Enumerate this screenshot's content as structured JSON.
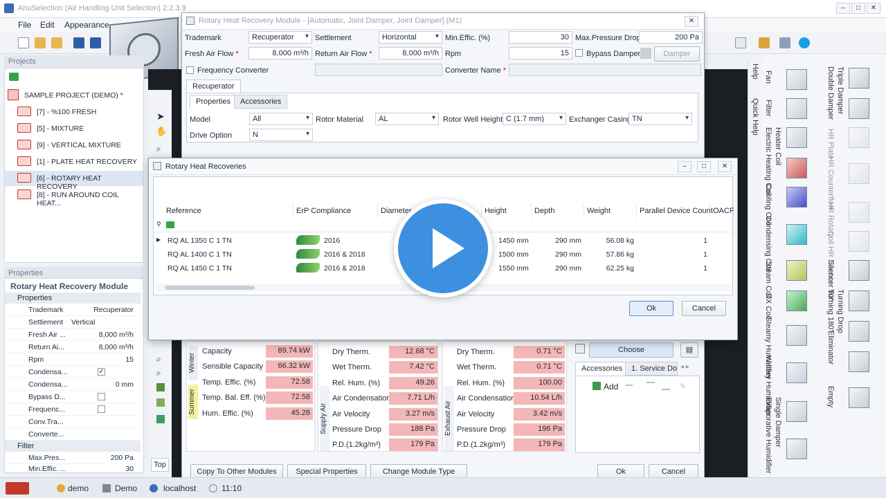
{
  "app": {
    "title": "AhuSelection (Air Handling Unit Selection) 2.2.3.9"
  },
  "menu": [
    "File",
    "Edit",
    "Appearance"
  ],
  "projects": {
    "header": "Projects",
    "root": "SAMPLE PROJECT (DEMO) *",
    "items": [
      "[7] - %100 FRESH",
      "[5] - MIXTURE",
      "[9] - VERTICAL MIXTURE",
      "[1] - PLATE HEAT RECOVERY",
      "[6] - ROTARY HEAT RECOVERY",
      "[8] - RUN AROUND COIL HEAT..."
    ]
  },
  "properties": {
    "header": "Properties",
    "title": "Rotary Heat Recovery Module",
    "group1": "Properties",
    "rows": [
      {
        "k": "Trademark",
        "v": "Recuperator"
      },
      {
        "k": "Settlement",
        "v": "Vertical"
      },
      {
        "k": "Fresh Air ...",
        "v": "8,000 m³/h"
      },
      {
        "k": "Return Ai...",
        "v": "8,000 m³/h"
      },
      {
        "k": "Rpm",
        "v": "15"
      },
      {
        "k": "Condensa...",
        "v": ""
      },
      {
        "k": "Condensa...",
        "v": "0 mm"
      },
      {
        "k": "Bypass D...",
        "v": ""
      },
      {
        "k": "Frequenc...",
        "v": ""
      },
      {
        "k": "Conv.Tra...",
        "v": ""
      },
      {
        "k": "Converte...",
        "v": ""
      }
    ],
    "group2": "Filter",
    "rows2": [
      {
        "k": "Max.Pres...",
        "v": "200 Pa"
      },
      {
        "k": "Min.Effic. ...",
        "v": "30"
      }
    ]
  },
  "module": {
    "title": "Rotary Heat Recovery Module - [Automatic, Joint Damper, Joint Damper] (M1)",
    "trademark_label": "Trademark",
    "trademark": "Recuperator",
    "settlement_label": "Settlement",
    "settlement": "Horizontal",
    "mineff_label": "Min.Effic. (%)",
    "mineff": "30",
    "maxpd_label": "Max.Pressure Drop",
    "maxpd": "200 Pa",
    "fresh_label": "Fresh Air Flow",
    "fresh": "8,000 m³/h",
    "return_label": "Return Air Flow",
    "return": "8,000 m³/h",
    "rpm_label": "Rpm",
    "rpm": "15",
    "bypass_label": "Bypass Damper",
    "damper_btn": "Damper",
    "freq_label": "Frequency Converter",
    "conv_label": "Converter Name",
    "tab_recuperator": "Recuperator",
    "tab_properties": "Properties",
    "tab_accessories": "Accessories",
    "model_label": "Model",
    "model": "All",
    "rotor_label": "Rotor Material",
    "rotor": "AL",
    "well_label": "Rotor Well Height",
    "well": "C (1.7 mm)",
    "casing_label": "Exchanger Casing",
    "casing": "TN",
    "drive_label": "Drive Option",
    "drive": "N",
    "winter": "Winter",
    "summer": "Summer",
    "perf": [
      {
        "k": "Capacity",
        "v": "89.74 kW"
      },
      {
        "k": "Sensible Capacity",
        "v": "66.32 kW"
      },
      {
        "k": "Temp. Effic. (%)",
        "v": "72.58"
      },
      {
        "k": "Temp. Bal. Eff. (%)",
        "v": "72.58"
      },
      {
        "k": "Hum. Effic. (%)",
        "v": "45.28"
      }
    ],
    "supply_label": "Supply Air",
    "supply": [
      {
        "k": "Dry Therm.",
        "v": "12.68 °C"
      },
      {
        "k": "Wet Therm.",
        "v": "7.42 °C"
      },
      {
        "k": "Rel. Hum. (%)",
        "v": "49.26"
      },
      {
        "k": "Air Condensation",
        "v": "7.71 L/h"
      },
      {
        "k": "Air Velocity",
        "v": "3.27 m/s"
      },
      {
        "k": "Pressure Drop",
        "v": "188 Pa"
      },
      {
        "k": "P.D.(1.2kg/m³)",
        "v": "179 Pa"
      }
    ],
    "exhaust_label": "Exhaust Air",
    "exhaust": [
      {
        "k": "Dry Therm.",
        "v": "0.71 °C"
      },
      {
        "k": "Wet Therm.",
        "v": "0.71 °C"
      },
      {
        "k": "Rel. Hum. (%)",
        "v": "100.00"
      },
      {
        "k": "Air Condensation",
        "v": "10.54 L/h"
      },
      {
        "k": "Air Velocity",
        "v": "3.42 m/s"
      },
      {
        "k": "Pressure Drop",
        "v": "196 Pa"
      },
      {
        "k": "P.D.(1.2kg/m³)",
        "v": "179 Pa"
      }
    ],
    "choose_btn": "Choose",
    "acc_tab1": "Accessories",
    "acc_tab2": "1. Service Doc",
    "add_btn": "Add",
    "copy_btn": "Copy To Other Modules",
    "special_btn": "Special Properties",
    "change_btn": "Change Module Type",
    "ok": "Ok",
    "cancel": "Cancel"
  },
  "rotary": {
    "title": "Rotary Heat Recoveries",
    "columns": [
      "Reference",
      "ErP Compliance",
      "Diameter",
      "Height",
      "Depth",
      "Weight",
      "Parallel Device Count",
      "OACF"
    ],
    "rows": [
      {
        "ref": "RQ AL 1350 C 1 TN",
        "erp": "2016",
        "height": "1450 mm",
        "depth": "290 mm",
        "weight": "56.08 kg",
        "count": "1"
      },
      {
        "ref": "RQ AL 1400 C 1 TN",
        "erp": "2016 & 2018",
        "height": "1500 mm",
        "depth": "290 mm",
        "weight": "57.86 kg",
        "count": "1"
      },
      {
        "ref": "RQ AL 1450 C 1 TN",
        "erp": "2016 & 2018",
        "height": "1550 mm",
        "depth": "290 mm",
        "weight": "62.25 kg",
        "count": "1"
      }
    ],
    "ok": "Ok",
    "cancel": "Cancel"
  },
  "side": {
    "help": "Help",
    "quickhelp": "Quick Help",
    "top": "Top"
  },
  "palette": {
    "col1": [
      "Fan",
      "Filter",
      "Electric Heating Coil",
      "Heater Coil",
      "Cooling Coil",
      "Condensing Coil",
      "Steam Coil",
      "DX Coil",
      "Steamy Humidifier",
      "Watery Humidifier",
      "Evaporative Humidifier",
      "Single Damper"
    ],
    "col2": [
      "Double Damper",
      "Triple Damper",
      "HR Plate",
      "HR Counterflow",
      "HR Rotary",
      "Coil HR Double",
      "Silencer 90°",
      "Turning 180°",
      "Turning Drop",
      "Eliminator",
      "Empty"
    ]
  },
  "status": {
    "user": "demo",
    "db": "Demo",
    "server": "localhost",
    "time": "11:10"
  }
}
